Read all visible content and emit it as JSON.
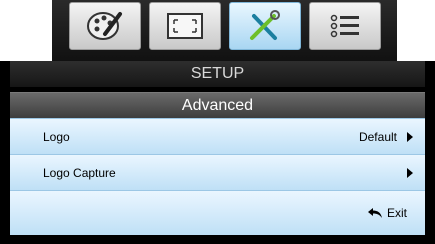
{
  "tabs": [
    {
      "icon": "palette-icon",
      "active": false
    },
    {
      "icon": "fullscreen-icon",
      "active": false
    },
    {
      "icon": "tools-icon",
      "active": true
    },
    {
      "icon": "list-icon",
      "active": false
    }
  ],
  "header": {
    "title": "SETUP",
    "subtitle": "Advanced"
  },
  "rows": [
    {
      "label": "Logo",
      "value": "Default"
    },
    {
      "label": "Logo Capture",
      "value": ""
    }
  ],
  "exit": {
    "label": "Exit",
    "icon": "return-arrow-icon"
  }
}
